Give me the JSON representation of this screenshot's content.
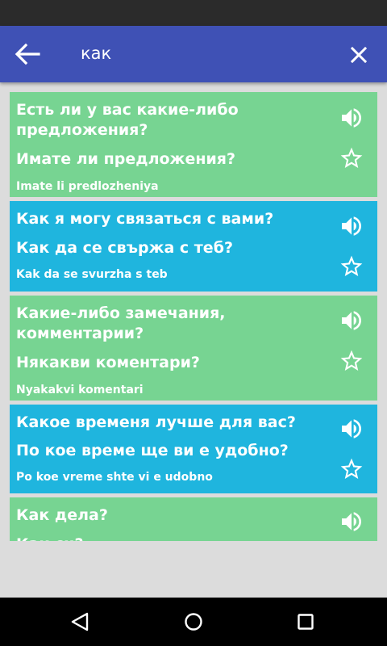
{
  "search": {
    "query": "как"
  },
  "colors": {
    "appbar": "#3f51b5",
    "card_green": "#77d492",
    "card_blue": "#1fb5de",
    "statusbar": "#2b2b2b"
  },
  "cards": [
    {
      "color": "green",
      "question": "Есть ли у вас какие-либо предложения?",
      "translation": "Имате ли предложения?",
      "transliteration": "Imate li predlozheniya"
    },
    {
      "color": "blue",
      "question": "Как я могу связаться с вами?",
      "translation": "Как да се свържа с теб?",
      "transliteration": "Kak da se svurzha s teb"
    },
    {
      "color": "green",
      "question": "Какие-либо замечания, комментарии?",
      "translation": "Някакви коментари?",
      "transliteration": "Nyakakvi komentari"
    },
    {
      "color": "blue",
      "question": "Какое временя лучше для вас?",
      "translation": "По кое време ще ви е удобно?",
      "transliteration": "Po koe vreme shte vi e udobno"
    },
    {
      "color": "green",
      "question": "Как дела?",
      "translation": "Как си?",
      "transliteration": ""
    }
  ],
  "icons": {
    "back": "arrow-left-icon",
    "close": "close-icon",
    "speaker": "speaker-icon",
    "star": "star-outline-icon",
    "nav_back": "triangle-back-icon",
    "nav_home": "circle-home-icon",
    "nav_recents": "square-recents-icon"
  }
}
